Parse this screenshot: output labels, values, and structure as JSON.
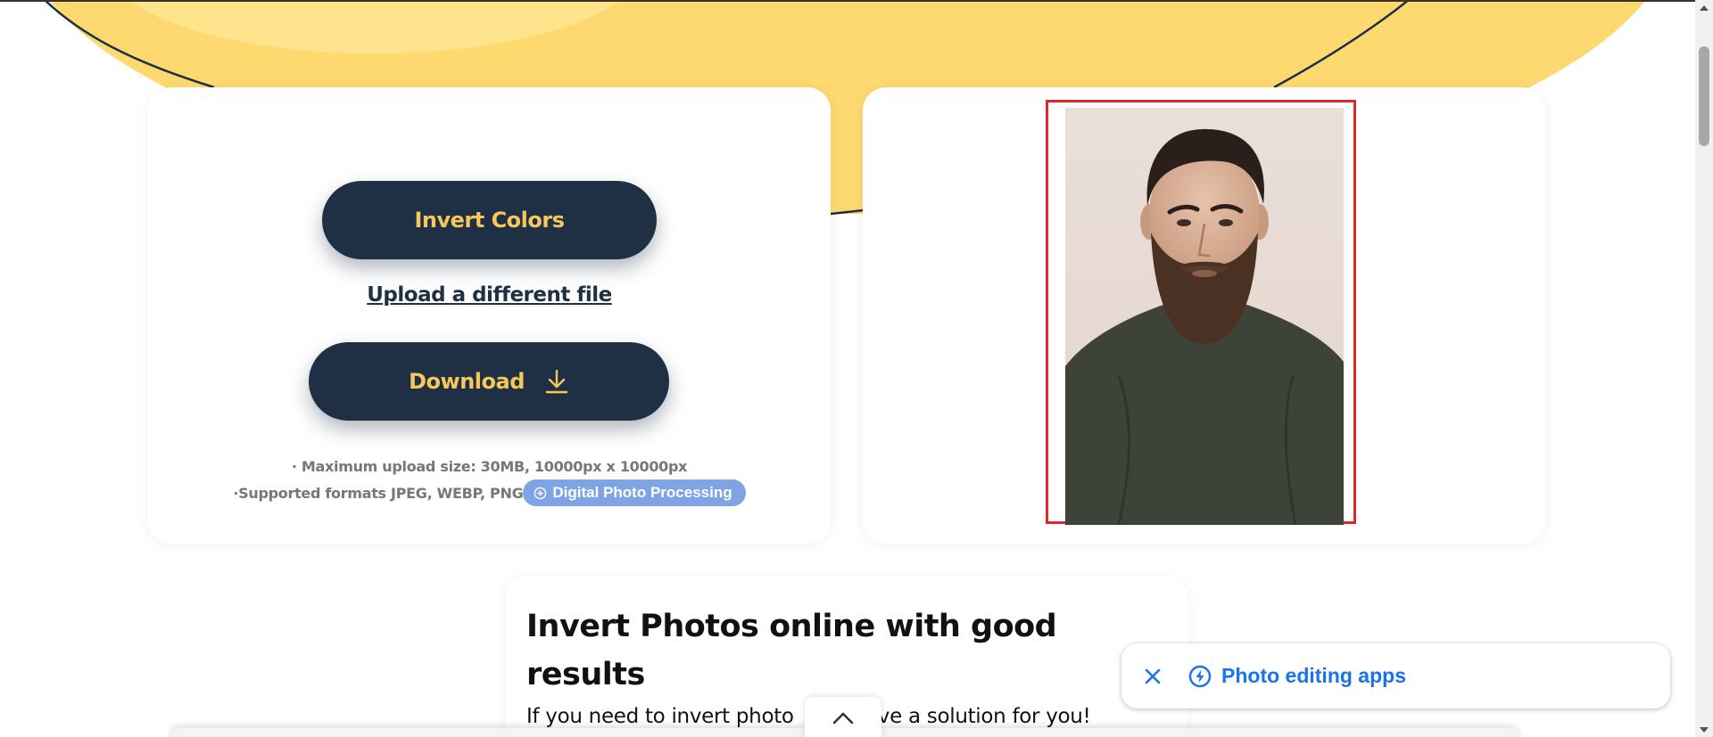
{
  "colors": {
    "primary_dark": "#1f3044",
    "accent_yellow": "#f7c75a",
    "badge_blue": "#7ea4e4",
    "link_blue": "#1a73e8",
    "frame_red": "#e0262f"
  },
  "tool": {
    "invert_label": "Invert Colors",
    "upload_label": "Upload a different file",
    "download_label": "Download",
    "download_icon": "download-arrow-icon",
    "max_size_text": "· Maximum upload size: 30MB, 10000px x 10000px",
    "formats_text": "·Supported formats JPEG, WEBP, PNG",
    "badge_label": "Digital Photo Processing",
    "badge_icon": "plus-circle-icon"
  },
  "preview": {
    "image": "portrait of bearded man in dark green t-shirt"
  },
  "article": {
    "title": "Invert Photos online with good results",
    "text_part1": "If you need to invert photo",
    "text_part2": "ave a solution for you!"
  },
  "popup": {
    "label": "Photo editing apps",
    "close_icon": "close-icon",
    "icon": "bolt-circle-icon"
  },
  "scroll_top": {
    "icon": "chevron-up-icon"
  }
}
